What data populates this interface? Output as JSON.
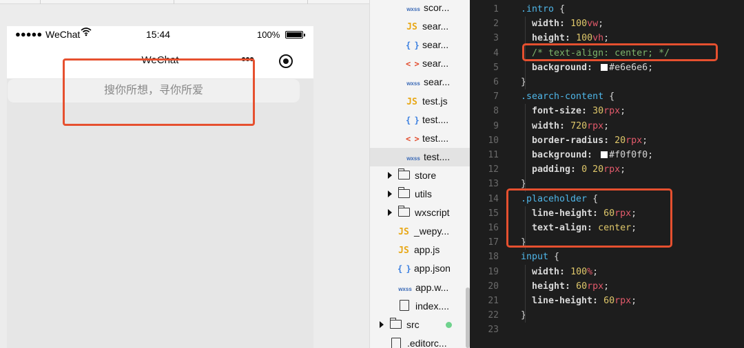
{
  "simulator": {
    "status": {
      "signal_dots": "●●●●●",
      "carrier": "WeChat",
      "wifi_icon": "wifi-icon",
      "time": "15:44",
      "battery_pct": "100%"
    },
    "navbar": {
      "title": "WeChat",
      "more_icon": "•••",
      "capsule_icon": "record-icon"
    },
    "search": {
      "placeholder": "搜你所想，寻你所爱"
    },
    "highlight_color": "#e6502f"
  },
  "file_tree": {
    "items": [
      {
        "icon": "wxss",
        "name": "scor..."
      },
      {
        "icon": "js",
        "name": "sear..."
      },
      {
        "icon": "json",
        "name": "sear..."
      },
      {
        "icon": "wxml",
        "name": "sear..."
      },
      {
        "icon": "wxss",
        "name": "sear..."
      },
      {
        "icon": "js",
        "name": "test.js"
      },
      {
        "icon": "json",
        "name": "test...."
      },
      {
        "icon": "wxml",
        "name": "test...."
      },
      {
        "icon": "wxss",
        "name": "test....",
        "active": true
      },
      {
        "icon": "folder",
        "name": "store"
      },
      {
        "icon": "folder",
        "name": "utils"
      },
      {
        "icon": "folder",
        "name": "wxscript"
      },
      {
        "icon": "js",
        "name": "_wepy..."
      },
      {
        "icon": "js",
        "name": "app.js"
      },
      {
        "icon": "json",
        "name": "app.json"
      },
      {
        "icon": "wxss",
        "name": "app.w..."
      },
      {
        "icon": "file",
        "name": "index...."
      },
      {
        "icon": "folder",
        "name": "src",
        "git_status": "added"
      },
      {
        "icon": "file",
        "name": ".editorc..."
      }
    ],
    "icon_glyphs": {
      "js": "JS",
      "json": "{ }",
      "wxml": "< >",
      "wxss": "wxss"
    }
  },
  "editor": {
    "lines": [
      {
        "n": "1",
        "code": ".intro {"
      },
      {
        "n": "2",
        "code": "width: 100vw;"
      },
      {
        "n": "3",
        "code": "height: 100vh;"
      },
      {
        "n": "4",
        "code": "/* text-align: center; */"
      },
      {
        "n": "5",
        "code": "background: #e6e6e6;"
      },
      {
        "n": "6",
        "code": "}"
      },
      {
        "n": "7",
        "code": ".search-content {"
      },
      {
        "n": "8",
        "code": "font-size: 30rpx;"
      },
      {
        "n": "9",
        "code": "width: 720rpx;"
      },
      {
        "n": "10",
        "code": "border-radius: 20rpx;"
      },
      {
        "n": "11",
        "code": "background: #f0f0f0;"
      },
      {
        "n": "12",
        "code": "padding: 0 20rpx;"
      },
      {
        "n": "13",
        "code": "}"
      },
      {
        "n": "14",
        "code": ".placeholder {"
      },
      {
        "n": "15",
        "code": "line-height: 60rpx;"
      },
      {
        "n": "16",
        "code": "text-align: center;"
      },
      {
        "n": "17",
        "code": "}"
      },
      {
        "n": "18",
        "code": "input {"
      },
      {
        "n": "19",
        "code": "width: 100%;"
      },
      {
        "n": "20",
        "code": "height: 60rpx;"
      },
      {
        "n": "21",
        "code": "line-height: 60rpx;"
      },
      {
        "n": "22",
        "code": "}"
      },
      {
        "n": "23",
        "code": ""
      }
    ],
    "colors": {
      "background": "#1d1d1d",
      "selector": "#4fb6e8",
      "number": "#dfc76a",
      "unit": "#e35a6b",
      "comment": "#7cb46b"
    }
  }
}
